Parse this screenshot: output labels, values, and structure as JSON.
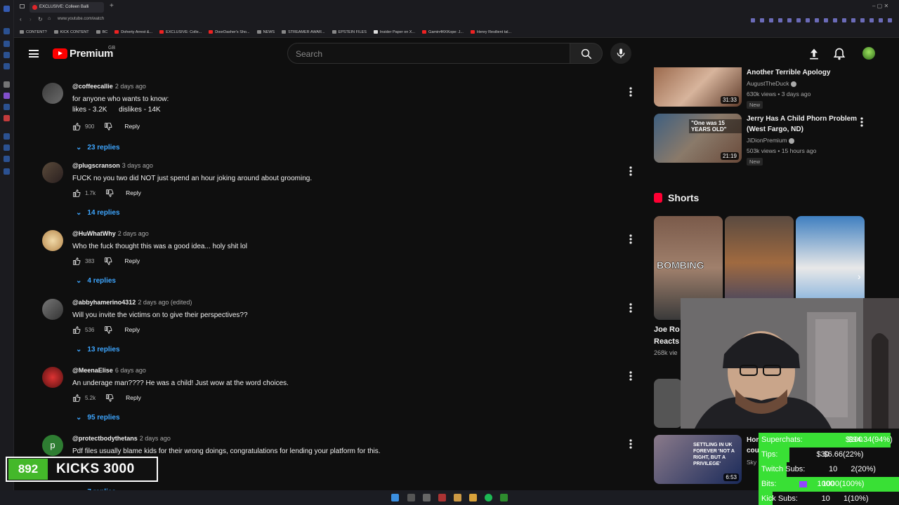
{
  "browser": {
    "tab_title": "EXCLUSIVE: Colleen Balli",
    "url": "www.youtube.com/watch",
    "bookmarks": [
      "CONTENT?",
      "KICK CONTENT",
      "BC",
      "Doherty Arrest &...",
      "EXCLUSIVE: Colle...",
      "DoorDasher's Sho...",
      "NEWS",
      "STREAMER AWAR...",
      "EPSTEIN FILES",
      "Insider Paper on X...",
      "Gamin4KKKope: J...",
      "Henry Resilient tal..."
    ]
  },
  "header": {
    "logo_text": "Premium",
    "region": "GB",
    "search_placeholder": "Search"
  },
  "comments": [
    {
      "author": "@coffeecallie",
      "date": "2 days ago",
      "text": "for anyone who wants to know:\nlikes - 3.2K      dislikes - 14K",
      "likes": "900",
      "reply": "Reply",
      "replies": "23 replies"
    },
    {
      "author": "@plugscranson",
      "date": "3 days ago",
      "text": "FUCK no you two did NOT just spend an hour joking around about grooming.",
      "likes": "1.7k",
      "reply": "Reply",
      "replies": "14 replies"
    },
    {
      "author": "@HuWhatWhy",
      "date": "2 days ago",
      "text": "Who the fuck thought this was a good idea... holy shit lol",
      "likes": "383",
      "reply": "Reply",
      "replies": "4 replies"
    },
    {
      "author": "@abbyhamerino4312",
      "date": "2 days ago (edited)",
      "text": "Will you invite the victims on to give their perspectives??",
      "likes": "536",
      "reply": "Reply",
      "replies": "13 replies"
    },
    {
      "author": "@MeenaElise",
      "date": "6 days ago",
      "text": "An underage man???? He was a child! Just wow at the word choices.",
      "likes": "5.2k",
      "reply": "Reply",
      "replies": "95 replies"
    },
    {
      "author": "@protectbodythetans",
      "date": "2 days ago",
      "text": "Pdf files usually blame kids for their wrong doings, congratulations for lending your platform for this.",
      "likes": "",
      "reply": "",
      "replies": "7 replies",
      "avatar_letter": "p"
    }
  ],
  "sidebar": {
    "videos": [
      {
        "title": "Another Terrible Apology",
        "channel": "AugustTheDuck",
        "meta": "630k views • 3 days ago",
        "badge": "New",
        "duration": "31:33"
      },
      {
        "title": "Jerry Has A Child Phorn Problem (West Fargo, ND)",
        "channel": "JiDionPremium",
        "meta": "503k views • 15 hours ago",
        "badge": "New",
        "duration": "21:19"
      }
    ],
    "shorts_title": "Shorts",
    "shorts": [
      {
        "overlay": "BOMBING",
        "title": "Joe Ro",
        "title2": "Reacts",
        "views": "268k vie"
      },
      {
        "overlay": "",
        "title": "",
        "views": ""
      },
      {
        "overlay": "",
        "title": "",
        "views": ""
      }
    ],
    "bottom_video": {
      "overlay": "SETTLING IN UK FOREVER 'NOT A RIGHT, BUT A PRIVILEGE'",
      "duration": "6:53",
      "title": "Hor",
      "title2": "cou",
      "channel": "Sky"
    },
    "thumb_overlay": "\"One was 15 YEARS OLD\""
  },
  "kicks": {
    "count": "892",
    "label": "KICKS",
    "goal": "3000"
  },
  "goals": [
    {
      "label": "Superchats:",
      "value": "$94.34(94%)",
      "goal": "$100",
      "progress": 0.94
    },
    {
      "label": "Tips:",
      "value": "$6.66(22%)",
      "goal": "$30",
      "progress": 0.22
    },
    {
      "label": "Twitch Subs:",
      "value": "2(20%)",
      "goal": "10",
      "progress": 0.2
    },
    {
      "label": "Bits:",
      "value": "1000(100%)",
      "goal": "1000",
      "progress": 1.0
    },
    {
      "label": "Kick Subs:",
      "value": "1(10%)",
      "goal": "10",
      "progress": 0.1
    }
  ]
}
